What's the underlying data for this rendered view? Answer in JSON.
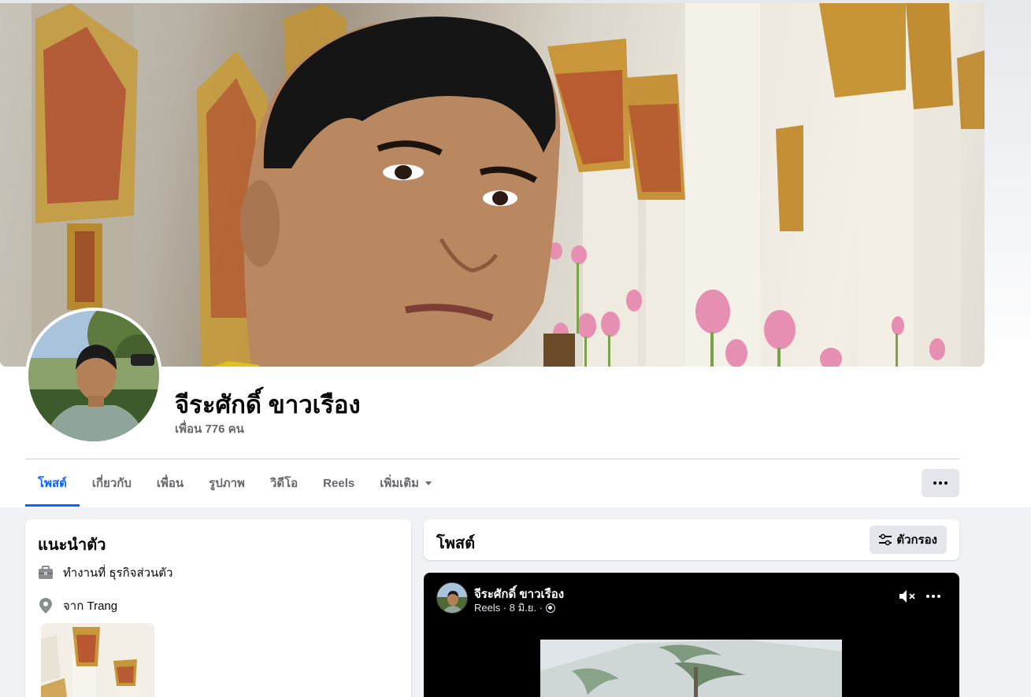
{
  "profile": {
    "name": "จีระศักดิ์ ขาวเรือง",
    "friends": "เพื่อน 776 คน"
  },
  "tabs": [
    {
      "label": "โพสต์",
      "active": true
    },
    {
      "label": "เกี่ยวกับ",
      "active": false
    },
    {
      "label": "เพื่อน",
      "active": false
    },
    {
      "label": "รูปภาพ",
      "active": false
    },
    {
      "label": "วิดีโอ",
      "active": false
    },
    {
      "label": "Reels",
      "active": false
    },
    {
      "label": "เพิ่มเติม",
      "active": false
    }
  ],
  "intro": {
    "title": "แนะนำตัว",
    "work": "ทำงานที่ ธุรกิจส่วนตัว",
    "from": "จาก Trang"
  },
  "posts": {
    "title": "โพสต์",
    "filter_label": "ตัวกรอง"
  },
  "reel_post": {
    "author": "จีระศักดิ์ ขาวเรือง",
    "meta": "Reels · 8 มิ.ย. ·"
  },
  "colors": {
    "accent": "#0866ff",
    "secondary_text": "#65676b",
    "button_bg": "#e4e6eb",
    "page_bg": "#f0f2f5"
  },
  "icons": {
    "more": "horizontal-dots-icon",
    "filter": "sliders-icon",
    "work": "briefcase-icon",
    "location": "map-pin-icon",
    "mute": "speaker-muted-icon",
    "audience": "globe-icon"
  }
}
